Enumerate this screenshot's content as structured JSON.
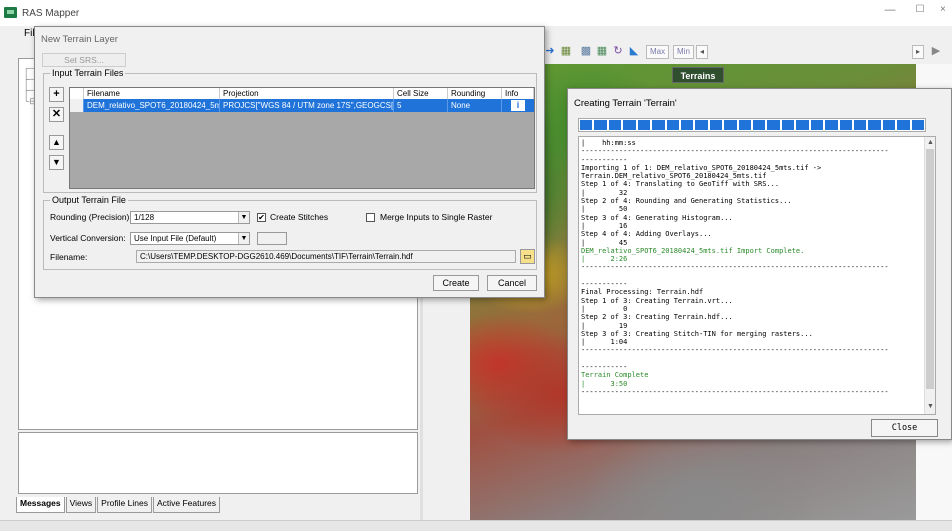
{
  "app": {
    "title": "RAS Mapper",
    "menu_file": "File",
    "window_min": "—",
    "window_max": "☐",
    "window_close": "×"
  },
  "map": {
    "layer_label": "Terrains",
    "toolbar_max": "Max",
    "toolbar_min": "Min"
  },
  "bottom_tabs": [
    "Messages",
    "Views",
    "Profile Lines",
    "Active Features"
  ],
  "new_terrain_dialog": {
    "title": "New Terrain Layer",
    "set_srs_label": "Set SRS...",
    "input_files_label": "Input Terrain Files",
    "columns": [
      "Filename",
      "Projection",
      "Cell Size",
      "Rounding",
      "Info"
    ],
    "rows": [
      {
        "filename": "DEM_relativo_SPOT6_20180424_5mts...",
        "projection": "PROJCS[\"WGS 84 / UTM zone 17S\",GEOGCS[...",
        "cell_size": "5",
        "rounding": "None",
        "info": "i"
      }
    ],
    "output_label": "Output Terrain File",
    "rounding_label": "Rounding (Precision):",
    "rounding_value": "1/128",
    "create_stitches_label": "Create Stitches",
    "create_stitches_checked": true,
    "merge_label": "Merge Inputs to Single Raster",
    "merge_checked": false,
    "vertical_label": "Vertical Conversion:",
    "vertical_value": "Use Input File (Default)",
    "filename_label": "Filename:",
    "filename_value": "C:\\Users\\TEMP.DESKTOP-DGG2610.469\\Documents\\TIF\\Terrain\\Terrain.hdf",
    "create_button": "Create",
    "cancel_button": "Cancel"
  },
  "creating_dialog": {
    "title": "Creating Terrain 'Terrain'",
    "progress_fraction": 1.0,
    "log_lines": [
      {
        "text": "|    hh:mm:ss",
        "color": "normal"
      },
      {
        "text": "-------------------------------------------------------------------------",
        "color": "normal"
      },
      {
        "text": "-----------",
        "color": "normal"
      },
      {
        "text": "Importing 1 of 1: DEM_relativo_SPOT6_20180424_5mts.tif ->",
        "color": "normal"
      },
      {
        "text": "Terrain.DEM_relativo_SPOT6_20180424_5mts.tif",
        "color": "normal"
      },
      {
        "text": "Step 1 of 4: Translating to GeoTiff with SRS...",
        "color": "normal"
      },
      {
        "text": "|        32",
        "color": "normal"
      },
      {
        "text": "Step 2 of 4: Rounding and Generating Statistics...",
        "color": "normal"
      },
      {
        "text": "|        50",
        "color": "normal"
      },
      {
        "text": "Step 3 of 4: Generating Histogram...",
        "color": "normal"
      },
      {
        "text": "|        16",
        "color": "normal"
      },
      {
        "text": "Step 4 of 4: Adding Overlays...",
        "color": "normal"
      },
      {
        "text": "|        45",
        "color": "normal"
      },
      {
        "text": "DEM_relativo_SPOT6_20180424_5mts.tif Import Complete.",
        "color": "green"
      },
      {
        "text": "|      2:26",
        "color": "green"
      },
      {
        "text": "-------------------------------------------------------------------------",
        "color": "normal"
      },
      {
        "text": "",
        "color": "normal"
      },
      {
        "text": "-----------",
        "color": "normal"
      },
      {
        "text": "Final Processing: Terrain.hdf",
        "color": "normal"
      },
      {
        "text": "Step 1 of 3: Creating Terrain.vrt...",
        "color": "normal"
      },
      {
        "text": "|         0",
        "color": "normal"
      },
      {
        "text": "Step 2 of 3: Creating Terrain.hdf...",
        "color": "normal"
      },
      {
        "text": "|        19",
        "color": "normal"
      },
      {
        "text": "Step 3 of 3: Creating Stitch-TIN for merging rasters...",
        "color": "normal"
      },
      {
        "text": "|      1:04",
        "color": "normal"
      },
      {
        "text": "-------------------------------------------------------------------------",
        "color": "normal"
      },
      {
        "text": "",
        "color": "normal"
      },
      {
        "text": "-----------",
        "color": "normal"
      },
      {
        "text": "Terrain Complete",
        "color": "green"
      },
      {
        "text": "|      3:50",
        "color": "green"
      },
      {
        "text": "-------------------------------------------------------------------------",
        "color": "normal"
      }
    ],
    "close_button": "Close"
  },
  "colors": {
    "selection_blue": "#1f73d9",
    "log_green": "#2a8a2a"
  }
}
